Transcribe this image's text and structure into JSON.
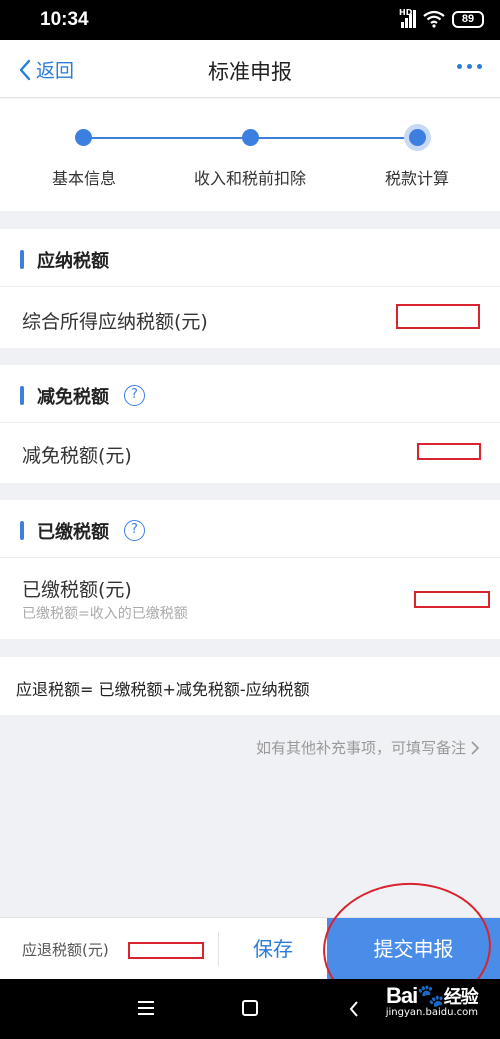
{
  "status_bar": {
    "time": "10:34",
    "hd_label": "HD",
    "battery": "89"
  },
  "nav": {
    "back_label": "返回",
    "title": "标准申报"
  },
  "steps": [
    {
      "label": "基本信息"
    },
    {
      "label": "收入和税前扣除"
    },
    {
      "label": "税款计算"
    }
  ],
  "sections": {
    "payable": {
      "title": "应纳税额",
      "row_label": "综合所得应纳税额(元)"
    },
    "reduction": {
      "title": "减免税额",
      "row_label": "减免税额(元)"
    },
    "paid": {
      "title": "已缴税额",
      "row_label": "已缴税额(元)",
      "row_sub": "已缴税额=收入的已缴税额"
    }
  },
  "help_glyph": "?",
  "formula": "应退税额= 已缴税额+减免税额-应纳税额",
  "remark_link": "如有其他补充事项，可填写备注",
  "bottom": {
    "refund_label": "应退税额(元)",
    "save_label": "保存",
    "submit_label": "提交申报"
  },
  "watermark": {
    "logo": "Bai",
    "logo_tail": "经验",
    "url": "jingyan.baidu.com"
  },
  "colors": {
    "accent": "#3d7fe0",
    "link": "#2a7cd8",
    "submit_bg": "#4a8de8",
    "annotation_red": "#d9232e"
  },
  "icons": [
    "back-chevron-icon",
    "more-icon",
    "help-icon",
    "chevron-right-icon",
    "menu-icon",
    "home-icon",
    "back-icon"
  ]
}
